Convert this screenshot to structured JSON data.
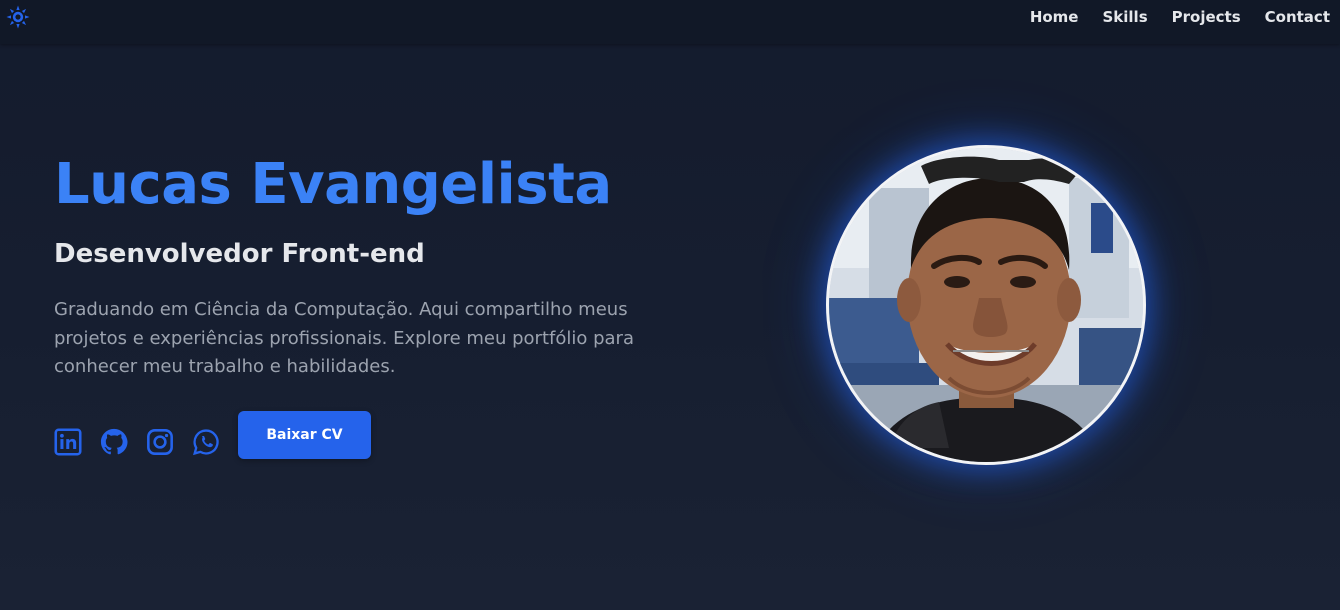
{
  "nav": {
    "logo_icon": "sun-gear-icon",
    "links": [
      "Home",
      "Skills",
      "Projects",
      "Contact"
    ]
  },
  "hero": {
    "name": "Lucas Evangelista",
    "role": "Desenvolvedor Front-end",
    "description": "Graduando em Ciência da Computação. Aqui compartilho meus projetos e experiências profissionais. Explore meu portfólio para conhecer meu trabalho e habilidades.",
    "cta_label": "Baixar CV",
    "socials": [
      "linkedin-icon",
      "github-icon",
      "instagram-icon",
      "whatsapp-icon"
    ],
    "avatar": "profile-photo"
  },
  "colors": {
    "accent": "#3b82f6",
    "button": "#2563eb",
    "background": "#161e30",
    "nav_background": "#111827"
  }
}
